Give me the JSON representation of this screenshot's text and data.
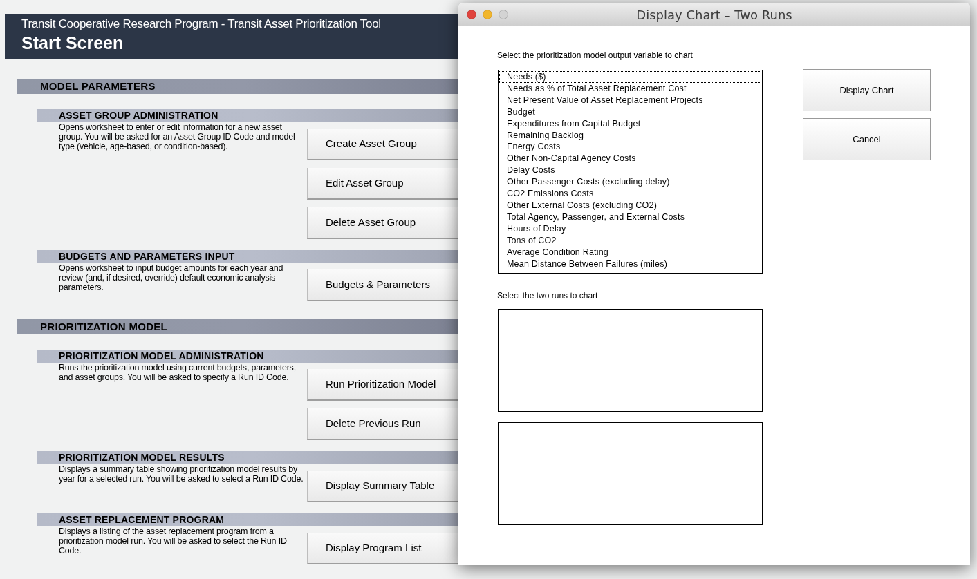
{
  "app": {
    "subtitle": "Transit Cooperative Research Program - Transit Asset Prioritization Tool",
    "title": "Start Screen"
  },
  "sections": [
    {
      "title": "MODEL PARAMETERS",
      "groups": [
        {
          "title": "ASSET GROUP ADMINISTRATION",
          "description": "Opens worksheet to enter or edit information for a new asset group. You will be asked for an Asset Group ID Code and model type (vehicle, age-based, or condition-based).",
          "buttons": [
            "Create Asset Group",
            "Edit Asset Group",
            "Delete Asset Group"
          ]
        },
        {
          "title": "BUDGETS AND PARAMETERS INPUT",
          "description": "Opens worksheet to input budget amounts for each year and review (and, if desired, override) default economic analysis parameters.",
          "buttons": [
            "Budgets & Parameters"
          ]
        }
      ]
    },
    {
      "title": "PRIORITIZATION MODEL",
      "groups": [
        {
          "title": "PRIORITIZATION MODEL ADMINISTRATION",
          "description": "Runs the prioritization model using current budgets, parameters, and asset groups. You will be asked to specify a Run ID Code.",
          "buttons": [
            "Run Prioritization Model",
            "Delete Previous Run"
          ]
        },
        {
          "title": "PRIORITIZATION MODEL RESULTS",
          "description": "Displays a summary table showing prioritization model results by year for a selected run. You will be asked to select a Run ID Code.",
          "buttons": [
            "Display Summary Table"
          ]
        },
        {
          "title": "ASSET REPLACEMENT PROGRAM",
          "description": "Displays a listing of the asset replacement program from a prioritization model run. You will be asked to select the Run ID Code.",
          "buttons": [
            "Display Program List"
          ]
        }
      ]
    }
  ],
  "dialog": {
    "title": "Display Chart – Two Runs",
    "variable_label": "Select the prioritization model output variable to chart",
    "variables": [
      {
        "label": "Needs ($)",
        "focused": true
      },
      {
        "label": "Needs as % of Total Asset Replacement Cost",
        "focused": false
      },
      {
        "label": "Net Present Value of Asset Replacement Projects",
        "focused": false
      },
      {
        "label": "Budget",
        "focused": false
      },
      {
        "label": "Expenditures from Capital Budget",
        "focused": false
      },
      {
        "label": "Remaining Backlog",
        "focused": false
      },
      {
        "label": "Energy Costs",
        "focused": false
      },
      {
        "label": "Other Non-Capital Agency Costs",
        "focused": false
      },
      {
        "label": "Delay Costs",
        "focused": false
      },
      {
        "label": "Other Passenger Costs (excluding delay)",
        "focused": false
      },
      {
        "label": "CO2 Emissions Costs",
        "focused": false
      },
      {
        "label": "Other External Costs (excluding CO2)",
        "focused": false
      },
      {
        "label": "Total Agency, Passenger, and External Costs",
        "focused": false
      },
      {
        "label": "Hours of Delay",
        "focused": false
      },
      {
        "label": "Tons of CO2",
        "focused": false
      },
      {
        "label": "Average Condition Rating",
        "focused": false
      },
      {
        "label": "Mean Distance Between Failures (miles)",
        "focused": false
      }
    ],
    "runs_label": "Select the two runs to chart",
    "buttons": [
      "Display Chart",
      "Cancel"
    ]
  }
}
